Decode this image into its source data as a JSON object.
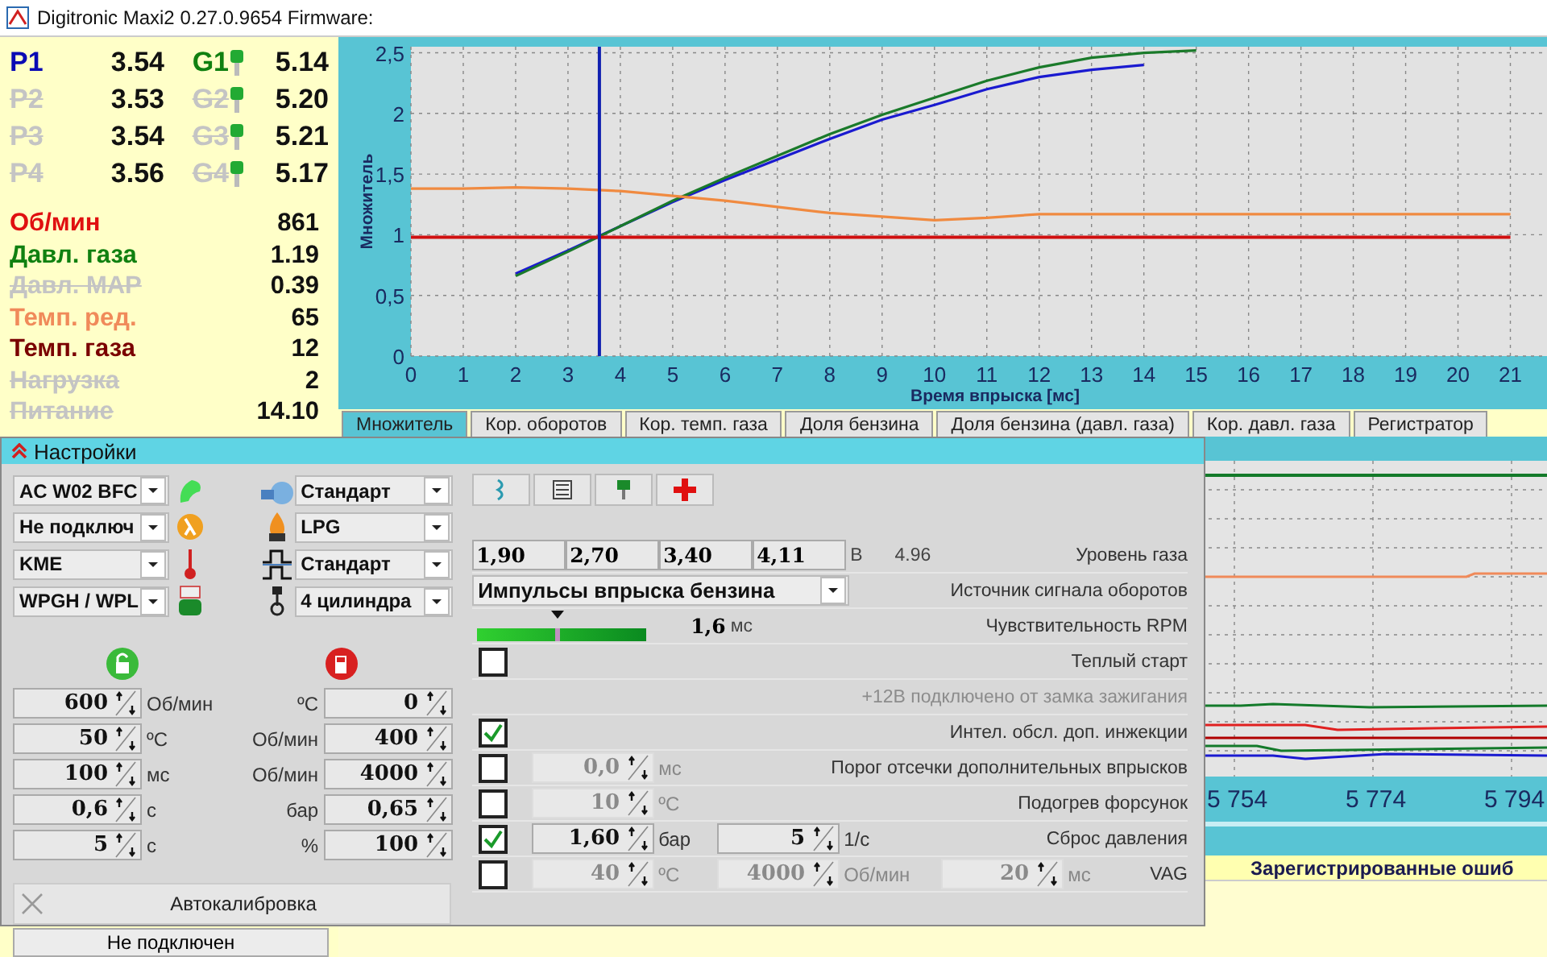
{
  "window": {
    "title": "Digitronic Maxi2 0.27.0.9654 Firmware:"
  },
  "injectors": [
    {
      "p_label": "P1",
      "p_value": "3.54",
      "p_active": true,
      "g_label": "G1",
      "g_value": "5.14",
      "g_active": true
    },
    {
      "p_label": "P2",
      "p_value": "3.53",
      "p_active": false,
      "g_label": "G2",
      "g_value": "5.20",
      "g_active": false
    },
    {
      "p_label": "P3",
      "p_value": "3.54",
      "p_active": false,
      "g_label": "G3",
      "g_value": "5.21",
      "g_active": false
    },
    {
      "p_label": "P4",
      "p_value": "3.56",
      "p_active": false,
      "g_label": "G4",
      "g_value": "5.17",
      "g_active": false
    }
  ],
  "readings": [
    {
      "label": "Об/мин",
      "value": "861",
      "active": true,
      "color": "#e01010"
    },
    {
      "label": "Давл. газа",
      "value": "1.19",
      "active": true,
      "color": "#108010"
    },
    {
      "label": "Давл. MAP",
      "value": "0.39",
      "active": false
    },
    {
      "label": "Темп. ред.",
      "value": "65",
      "active": true,
      "color": "#f08a5a"
    },
    {
      "label": "Темп. газа",
      "value": "12",
      "active": true,
      "color": "#7a0000"
    },
    {
      "label": "Нагрузка",
      "value": "2",
      "active": false
    },
    {
      "label": "Питание",
      "value": "14.10",
      "active": false
    }
  ],
  "gas_sensor_select": {
    "value": "Не подключен"
  },
  "chart": {
    "chart_data": {
      "type": "line",
      "xlabel": "Время впрыска [мс]",
      "ylabel": "Множитель",
      "x": [
        0,
        1,
        2,
        3,
        4,
        5,
        6,
        7,
        8,
        9,
        10,
        11,
        12,
        13,
        14,
        15,
        16,
        17,
        18,
        19,
        20,
        21
      ],
      "series": [
        {
          "color": "#1a1ad0",
          "values": [
            null,
            null,
            0.68,
            0.87,
            1.07,
            1.27,
            1.45,
            1.62,
            1.79,
            1.95,
            2.07,
            2.2,
            2.3,
            2.36,
            2.4,
            null,
            null,
            null,
            null,
            null,
            null,
            null
          ]
        },
        {
          "color": "#1a7a2a",
          "values": [
            null,
            null,
            0.66,
            0.86,
            1.07,
            1.28,
            1.47,
            1.65,
            1.83,
            1.99,
            2.13,
            2.27,
            2.38,
            2.46,
            2.5,
            2.52,
            null,
            null,
            null,
            null,
            null,
            null
          ]
        },
        {
          "color": "#f08a40",
          "values": [
            1.38,
            1.38,
            1.39,
            1.38,
            1.36,
            1.32,
            1.28,
            1.23,
            1.18,
            1.15,
            1.12,
            1.14,
            1.17,
            1.17,
            1.17,
            1.17,
            1.17,
            1.17,
            1.17,
            1.17,
            1.17,
            1.17
          ]
        },
        {
          "color": "#d01010",
          "values": [
            0.98,
            0.98,
            0.98,
            0.98,
            0.98,
            0.98,
            0.98,
            0.98,
            0.98,
            0.98,
            0.98,
            0.98,
            0.98,
            0.98,
            0.98,
            0.98,
            0.98,
            0.98,
            0.98,
            0.98,
            0.98,
            0.98
          ]
        }
      ],
      "xlim": [
        0,
        21.7
      ],
      "ylim": [
        0,
        2.55
      ],
      "xticks": [
        0,
        1,
        2,
        3,
        4,
        5,
        6,
        7,
        8,
        9,
        10,
        11,
        12,
        13,
        14,
        15,
        16,
        17,
        18,
        19,
        20,
        21
      ],
      "yticks": [
        0,
        {
          "value": 0.5,
          "label": "0,5"
        },
        1,
        {
          "value": 1.5,
          "label": "1,5"
        },
        2,
        {
          "value": 2.5,
          "label": "2,5"
        }
      ],
      "grid": true,
      "ref_lines": [
        {
          "axis": "x",
          "value": 3.6
        }
      ]
    }
  },
  "tabs": [
    {
      "label": "Множитель",
      "selected": true
    },
    {
      "label": "Кор. оборотов",
      "selected": false
    },
    {
      "label": "Кор. темп. газа",
      "selected": false
    },
    {
      "label": "Доля бензина",
      "selected": false
    },
    {
      "label": "Доля бензина (давл. газа)",
      "selected": false
    },
    {
      "label": "Кор. давл. газа",
      "selected": false
    },
    {
      "label": "Регистратор",
      "selected": false
    }
  ],
  "recorder": {
    "x_labels": [
      "5 754",
      "5 774",
      "5 794"
    ],
    "errors_title": "Зарегистрированные ошиб"
  },
  "settings": {
    "title": "Настройки",
    "left_selects": [
      {
        "value": "AC W02 BFC"
      },
      {
        "value": "Не подключ"
      },
      {
        "value": "KME"
      },
      {
        "value": "WPGH / WPL"
      }
    ],
    "right_selects": [
      {
        "value": "Стандарт"
      },
      {
        "value": "LPG"
      },
      {
        "value": "Стандарт"
      },
      {
        "value": "4 цилиндра"
      }
    ],
    "left_params": [
      {
        "value": "600",
        "unit": "Об/мин"
      },
      {
        "value": "50",
        "unit": "ºC"
      },
      {
        "value": "100",
        "unit": "мс"
      },
      {
        "value": "0,6",
        "unit": "с"
      },
      {
        "value": "5",
        "unit": "с"
      }
    ],
    "right_params": [
      {
        "unit": "ºC",
        "value": "0"
      },
      {
        "unit": "Об/мин",
        "value": "400"
      },
      {
        "unit": "Об/мин",
        "value": "4000"
      },
      {
        "unit": "бар",
        "value": "0,65"
      },
      {
        "unit": "%",
        "value": "100"
      }
    ],
    "autocalibration": "Автокалибровка",
    "gas_level": {
      "values": [
        "1,90",
        "2,70",
        "3,40",
        "4,11"
      ],
      "unit": "В",
      "reading": "4.96",
      "label": "Уровень газа"
    },
    "rpm_source": {
      "value": "Импульсы впрыска бензина",
      "label": "Источник сигнала оборотов"
    },
    "rpm_sensitivity": {
      "level": 0.48,
      "reading": "1,6",
      "unit": "мс",
      "label": "Чувствительность RPM"
    },
    "rows": [
      {
        "kind": "check",
        "checked": false,
        "label": "Теплый старт"
      },
      {
        "kind": "note",
        "label": "+12В подключено от замка зажигания"
      },
      {
        "kind": "check",
        "checked": true,
        "label": "Интел. обсл. доп. инжекции"
      },
      {
        "kind": "check",
        "checked": false,
        "label": "Порог отсечки дополнительных впрысков",
        "fields": [
          {
            "value": "0,0",
            "unit": "мс"
          }
        ]
      },
      {
        "kind": "check",
        "checked": false,
        "label": "Подогрев форсунок",
        "fields": [
          {
            "value": "10",
            "unit": "ºC"
          }
        ]
      },
      {
        "kind": "check",
        "checked": true,
        "label": "Сброс давления",
        "fields": [
          {
            "value": "1,60",
            "unit": "бар"
          },
          {
            "value": "5",
            "unit": "1/с"
          }
        ]
      },
      {
        "kind": "check",
        "checked": false,
        "label": "VAG",
        "fields": [
          {
            "value": "40",
            "unit": "ºC"
          },
          {
            "value": "4000",
            "unit": "Об/мин"
          },
          {
            "value": "20",
            "unit": "мс"
          }
        ]
      }
    ]
  }
}
